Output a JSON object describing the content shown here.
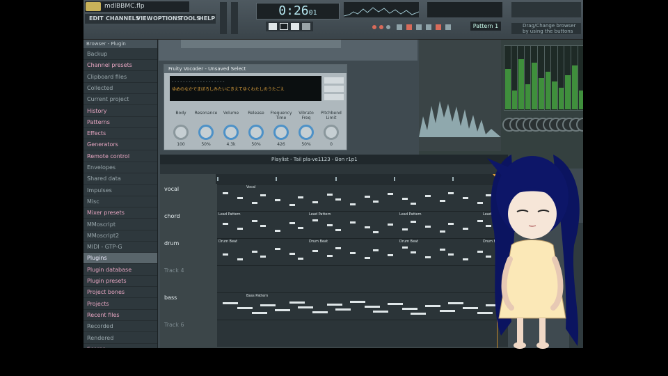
{
  "window": {
    "title": "mdlBBMC.flp"
  },
  "menu": [
    "EDIT",
    "CHANNELS",
    "VIEW",
    "OPTIONS",
    "TOOLS",
    "HELP"
  ],
  "transport": {
    "time": "0:26",
    "time_sub": "01"
  },
  "hint": "Drag/Change browser by using the buttons",
  "pattern_selector": "Pattern 1",
  "browser": {
    "header": "Browser - Plugin",
    "items": [
      {
        "label": "Backup",
        "style": "plain"
      },
      {
        "label": "Channel presets",
        "style": "pink"
      },
      {
        "label": "Clipboard files",
        "style": "plain"
      },
      {
        "label": "Collected",
        "style": "plain"
      },
      {
        "label": "Current project",
        "style": "plain"
      },
      {
        "label": "History",
        "style": "pink"
      },
      {
        "label": "Patterns",
        "style": "pink"
      },
      {
        "label": "Effects",
        "style": "pink"
      },
      {
        "label": "Generators",
        "style": "pink"
      },
      {
        "label": "Remote control",
        "style": "pink"
      },
      {
        "label": "Envelopes",
        "style": "plain"
      },
      {
        "label": "Shared data",
        "style": "plain"
      },
      {
        "label": "Impulses",
        "style": "plain"
      },
      {
        "label": "Misc",
        "style": "plain"
      },
      {
        "label": "Mixer presets",
        "style": "pink"
      },
      {
        "label": "MMoscript",
        "style": "plain"
      },
      {
        "label": "MMoscript2",
        "style": "plain"
      },
      {
        "label": "MIDI - GTP-G",
        "style": "plain"
      },
      {
        "label": "Plugins",
        "style": "sel"
      },
      {
        "label": "Plugin database",
        "style": "pink"
      },
      {
        "label": "Plugin presets",
        "style": "pink"
      },
      {
        "label": "Project bones",
        "style": "pink"
      },
      {
        "label": "Projects",
        "style": "pink"
      },
      {
        "label": "Recent files",
        "style": "pink"
      },
      {
        "label": "Recorded",
        "style": "plain"
      },
      {
        "label": "Rendered",
        "style": "plain"
      },
      {
        "label": "Scores",
        "style": "pink"
      }
    ]
  },
  "plugin": {
    "title": "Fruity Vocoder - Unsaved Select",
    "lyric": "ゆめのなかでまぼろしみたいにきえてゆくわたしのうたごえ",
    "knobs": [
      {
        "label": "Body",
        "value": "100"
      },
      {
        "label": "Resonance",
        "value": "50%"
      },
      {
        "label": "Volume",
        "value": "4.3k"
      },
      {
        "label": "Release",
        "value": "50%"
      },
      {
        "label": "Frequency Time",
        "value": "426"
      },
      {
        "label": "Vibrato Freq",
        "value": "50%"
      },
      {
        "label": "Pitchbend Limit",
        "value": "0"
      }
    ]
  },
  "playlist": {
    "title": "Playlist - Tail pla-ve1123 - Bon r1p1",
    "tracks": [
      {
        "label": "vocal",
        "dim": false,
        "clip": "Vocal"
      },
      {
        "label": "chord",
        "dim": false,
        "clip": "Lead Pattern"
      },
      {
        "label": "drum",
        "dim": false,
        "clip": "Drum Beat"
      },
      {
        "label": "Track 4",
        "dim": true,
        "clip": ""
      },
      {
        "label": "bass",
        "dim": false,
        "clip": "Bass Pattern"
      },
      {
        "label": "Track 6",
        "dim": true,
        "clip": ""
      }
    ]
  },
  "mixer": {
    "levels": [
      0.65,
      0.3,
      0.8,
      0.4,
      0.75,
      0.5,
      0.6,
      0.45,
      0.35,
      0.55,
      0.7,
      0.3
    ]
  },
  "colors": {
    "accent": "#e8a33a",
    "browser_pink": "#e7a6c2",
    "lyric_text": "#e0a33d"
  }
}
